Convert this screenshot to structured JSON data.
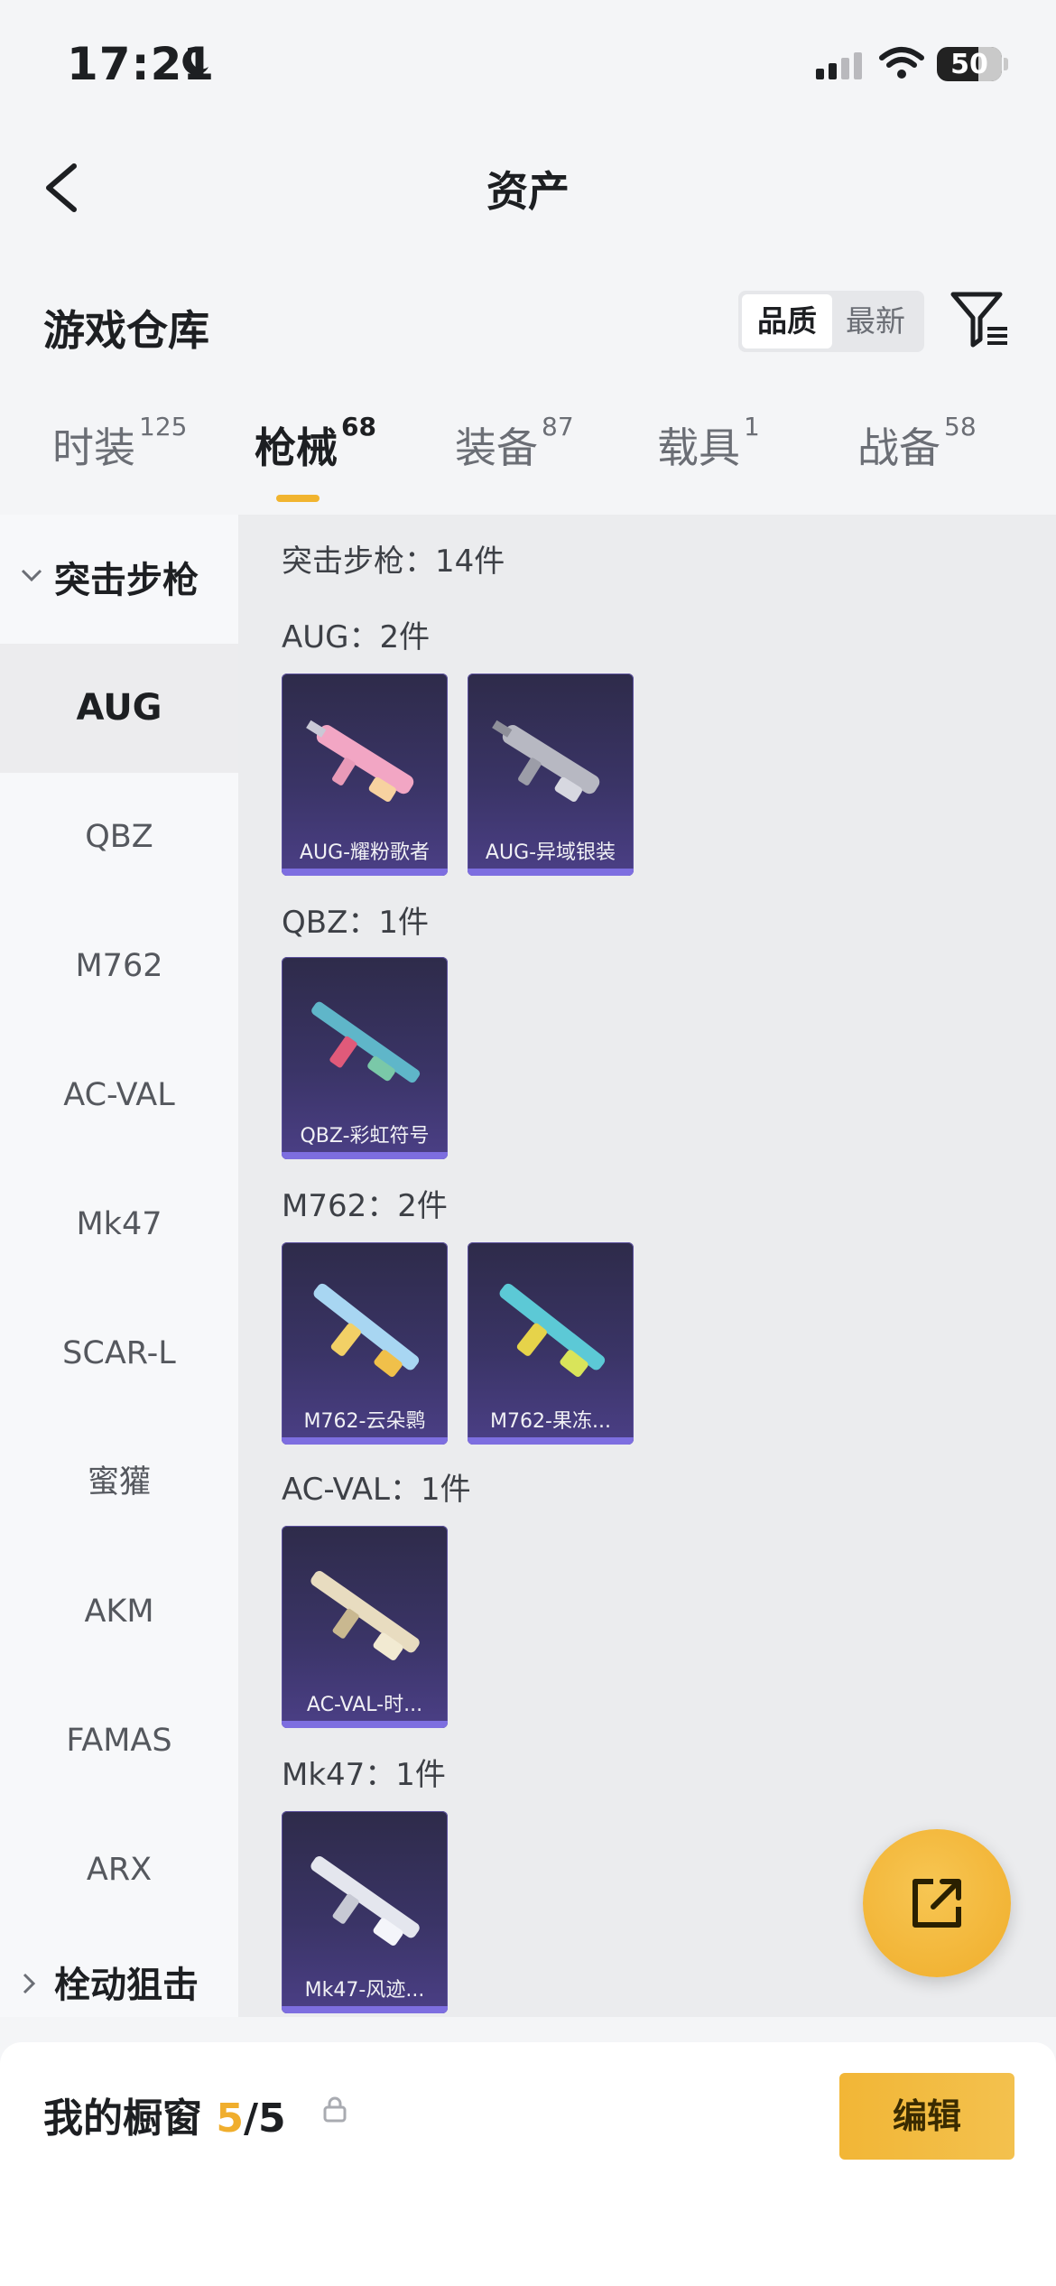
{
  "status_bar": {
    "time": "17:21",
    "battery": "50"
  },
  "nav": {
    "title": "资产"
  },
  "warehouse": {
    "title": "游戏仓库",
    "sort_options": [
      "品质",
      "最新"
    ]
  },
  "tabs": [
    {
      "label": "时装",
      "count": "125"
    },
    {
      "label": "枪械",
      "count": "68"
    },
    {
      "label": "装备",
      "count": "87"
    },
    {
      "label": "载具",
      "count": "1"
    },
    {
      "label": "战备",
      "count": "58"
    }
  ],
  "sidebar": {
    "group_open": "突击步枪",
    "items": [
      "AUG",
      "QBZ",
      "M762",
      "AC-VAL",
      "Mk47",
      "SCAR-L",
      "蜜獾",
      "AKM",
      "FAMAS",
      "ARX"
    ],
    "group_next": "栓动狙击"
  },
  "content": {
    "summary": "突击步枪：14件",
    "sections": [
      {
        "title": "AUG：2件",
        "items": [
          "AUG-耀粉歌者",
          "AUG-异域银装"
        ]
      },
      {
        "title": "QBZ：1件",
        "items": [
          "QBZ-彩虹符号"
        ]
      },
      {
        "title": "M762：2件",
        "items": [
          "M762-云朵鹮",
          "M762-果冻..."
        ]
      },
      {
        "title": "AC-VAL：1件",
        "items": [
          "AC-VAL-时..."
        ]
      },
      {
        "title": "Mk47：1件",
        "items": [
          "Mk47-风迹..."
        ]
      }
    ]
  },
  "showcase": {
    "label": "我的橱窗",
    "current": "5",
    "total": "/5",
    "edit_label": "编辑"
  },
  "colors": {
    "accent": "#f1b42f",
    "card_bg": "#3a3466",
    "card_bar": "#7d6ee0"
  },
  "icons": [
    "back-icon",
    "filter-icon",
    "share-icon",
    "lock-icon",
    "chevron-down-icon",
    "chevron-right-icon",
    "moon-icon",
    "signal-icon",
    "wifi-icon"
  ]
}
